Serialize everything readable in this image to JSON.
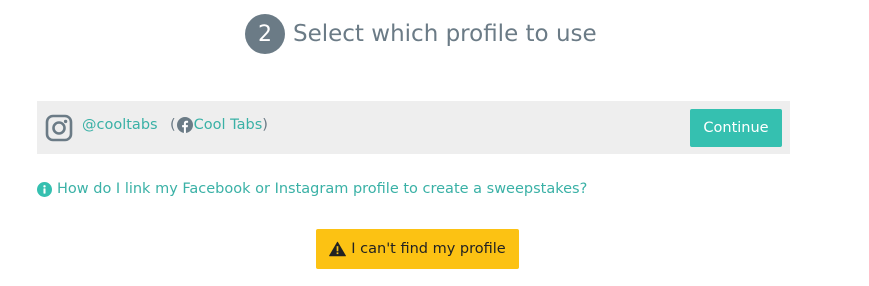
{
  "step": {
    "number": "2",
    "title": "Select which profile to use"
  },
  "profile": {
    "instagram_icon": "instagram-icon",
    "instagram_handle": "@cooltabs",
    "paren_open": "(",
    "facebook_icon": "facebook-icon",
    "facebook_page": "Cool Tabs",
    "paren_close": ")",
    "continue_label": "Continue"
  },
  "help": {
    "icon": "info-icon",
    "link_text": "How do I link my Facebook or Instagram profile to create a sweepstakes?"
  },
  "cant_find": {
    "icon": "warning-icon",
    "label": "I can't find my profile"
  },
  "colors": {
    "accent_teal": "#35c0b0",
    "link_teal": "#3ab1a6",
    "step_gray": "#6b7b86",
    "row_background": "#eeeeee",
    "warning_yellow": "#fcc213"
  }
}
